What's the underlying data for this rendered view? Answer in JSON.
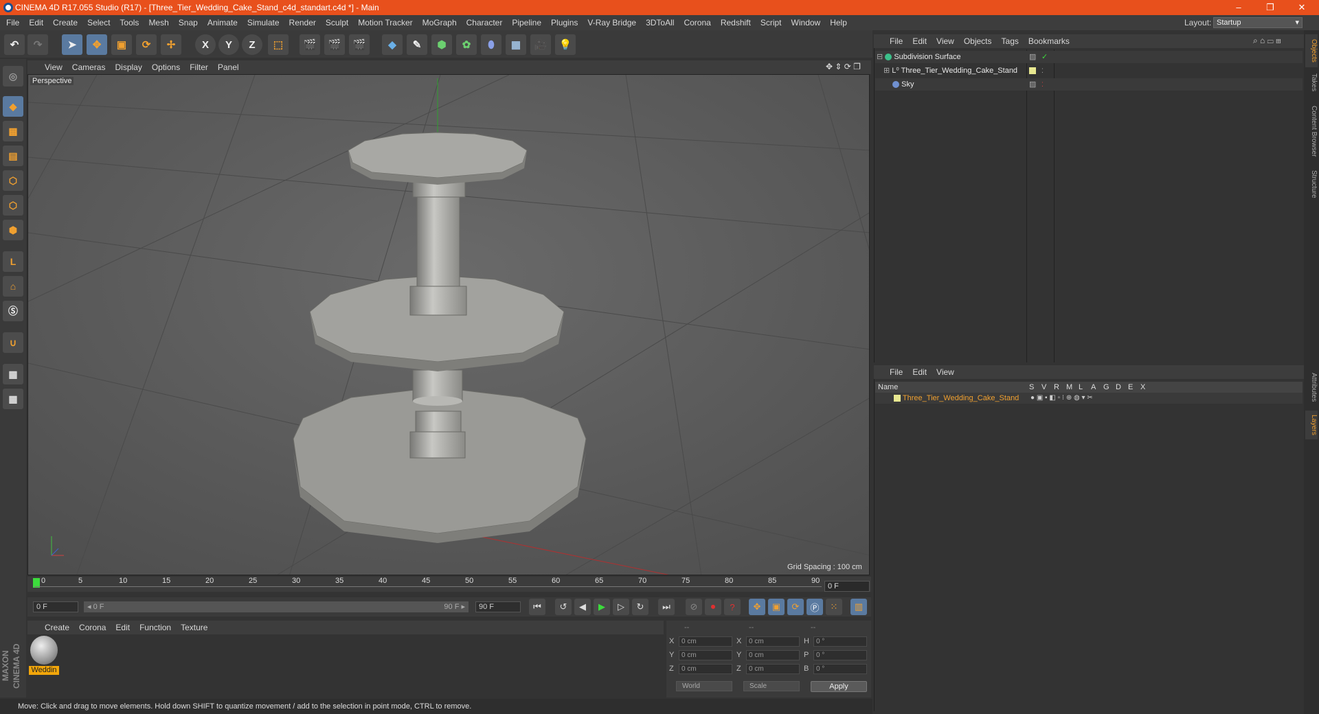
{
  "window": {
    "title": "CINEMA 4D R17.055 Studio (R17) - [Three_Tier_Wedding_Cake_Stand_c4d_standart.c4d *] - Main",
    "minimize": "–",
    "maximize": "❐",
    "close": "✕"
  },
  "menubar": {
    "items": [
      "File",
      "Edit",
      "Create",
      "Select",
      "Tools",
      "Mesh",
      "Snap",
      "Animate",
      "Simulate",
      "Render",
      "Sculpt",
      "Motion Tracker",
      "MoGraph",
      "Character",
      "Pipeline",
      "Plugins",
      "V-Ray Bridge",
      "3DToAll",
      "Corona",
      "Redshift",
      "Script",
      "Window",
      "Help"
    ],
    "layout_label": "Layout:",
    "layout_value": "Startup"
  },
  "toolbar": {
    "undo": "↶",
    "redo": "↷",
    "axis_x": "X",
    "axis_y": "Y",
    "axis_z": "Z"
  },
  "viewport": {
    "menu": [
      "View",
      "Cameras",
      "Display",
      "Options",
      "Filter",
      "Panel"
    ],
    "camera_label": "Perspective",
    "grid_spacing": "Grid Spacing : 100 cm"
  },
  "timeline": {
    "ticks": [
      "0",
      "5",
      "10",
      "15",
      "20",
      "25",
      "30",
      "35",
      "40",
      "45",
      "50",
      "55",
      "60",
      "65",
      "70",
      "75",
      "80",
      "85",
      "90"
    ],
    "current_frame": "0 F",
    "start_field": "0 F",
    "range_start": "◂ 0 F",
    "range_end": "90 F ▸",
    "end_field": "90 F"
  },
  "materials": {
    "menu": [
      "Create",
      "Corona",
      "Edit",
      "Function",
      "Texture"
    ],
    "items": [
      {
        "label": "Weddin"
      }
    ]
  },
  "coordinates": {
    "headers": [
      "--",
      "--",
      "--"
    ],
    "rows": [
      {
        "a": "X",
        "av": "0 cm",
        "b": "X",
        "bv": "0 cm",
        "c": "H",
        "cv": "0 °"
      },
      {
        "a": "Y",
        "av": "0 cm",
        "b": "Y",
        "bv": "0 cm",
        "c": "P",
        "cv": "0 °"
      },
      {
        "a": "Z",
        "av": "0 cm",
        "b": "Z",
        "bv": "0 cm",
        "c": "B",
        "cv": "0 °"
      }
    ],
    "mode": "World",
    "transform": "Scale",
    "apply": "Apply"
  },
  "status": "Move: Click and drag to move elements. Hold down SHIFT to quantize movement / add to the selection in point mode, CTRL to remove.",
  "objects": {
    "menu": [
      "File",
      "Edit",
      "View",
      "Objects",
      "Tags",
      "Bookmarks"
    ],
    "rows": [
      {
        "name": "Subdivision Surface"
      },
      {
        "name": "Three_Tier_Wedding_Cake_Stand"
      },
      {
        "name": "Sky"
      }
    ]
  },
  "layers": {
    "menu": [
      "File",
      "Edit",
      "View"
    ],
    "header_name": "Name",
    "columns": [
      "S",
      "V",
      "R",
      "M",
      "L",
      "A",
      "G",
      "D",
      "E",
      "X"
    ],
    "row_name": "Three_Tier_Wedding_Cake_Stand"
  },
  "side_tabs": [
    "Objects",
    "Takes",
    "Content Browser",
    "Structure",
    "Attributes",
    "Layers"
  ],
  "brand": "MAXON CINEMA 4D"
}
